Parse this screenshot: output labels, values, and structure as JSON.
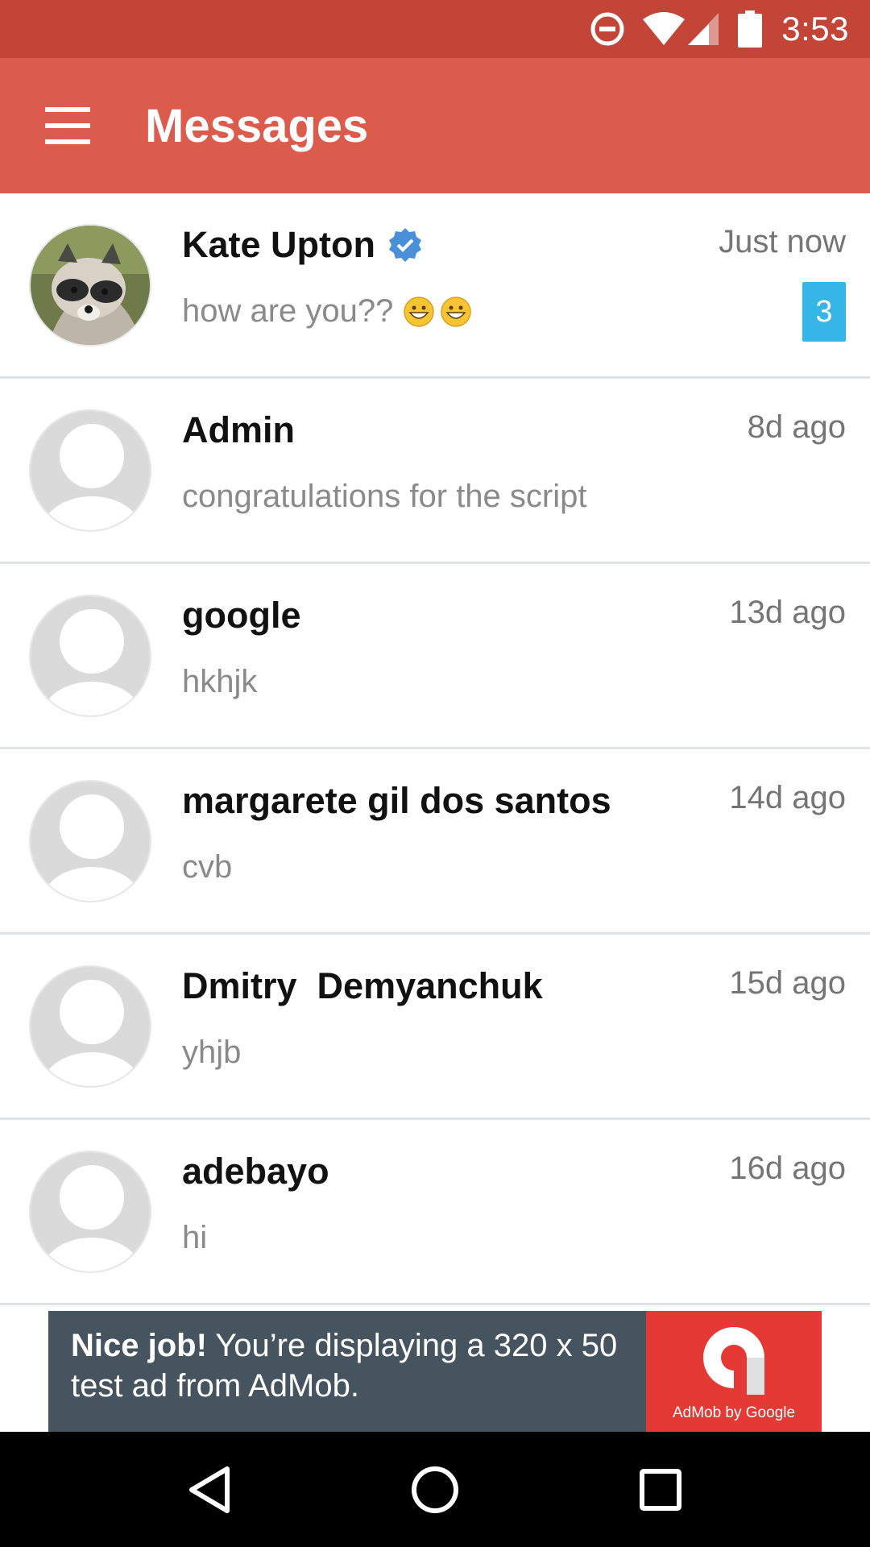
{
  "status_bar": {
    "time": "3:53",
    "icons": [
      "do-not-disturb-icon",
      "wifi-icon",
      "cell-signal-icon",
      "battery-icon"
    ]
  },
  "app_bar": {
    "title": "Messages",
    "menu_icon": "hamburger-menu-icon"
  },
  "colors": {
    "status_bar": "#c24537",
    "app_bar": "#db5b4c",
    "unread_badge": "#35b6e6",
    "verified": "#4a90d9"
  },
  "conversations": [
    {
      "name": "Kate Upton",
      "verified": true,
      "time": "Just now",
      "preview": "how are you??",
      "preview_emojis": [
        "grinning-face-icon",
        "grinning-face-icon"
      ],
      "unread": "3",
      "avatar": "raccoon-photo"
    },
    {
      "name": "Admin",
      "time": "8d ago",
      "preview": "congratulations for the script",
      "avatar": "default-avatar-icon"
    },
    {
      "name": "google",
      "time": "13d ago",
      "preview": "hkhjk",
      "avatar": "default-avatar-icon"
    },
    {
      "name": "margarete gil dos santos",
      "time": "14d ago",
      "preview": "cvb",
      "avatar": "default-avatar-icon"
    },
    {
      "name": "Dmitry  Demyanchuk",
      "time": "15d ago",
      "preview": "yhjb",
      "avatar": "default-avatar-icon"
    },
    {
      "name": "adebayo",
      "time": "16d ago",
      "preview": "hi",
      "avatar": "default-avatar-icon"
    }
  ],
  "ad": {
    "headline": "Nice job!",
    "body": " You’re displaying a 320 x 50 test ad from AdMob.",
    "logo_caption": "AdMob by Google"
  },
  "nav_bar": {
    "buttons": [
      "back-icon",
      "home-icon",
      "recents-icon"
    ]
  }
}
